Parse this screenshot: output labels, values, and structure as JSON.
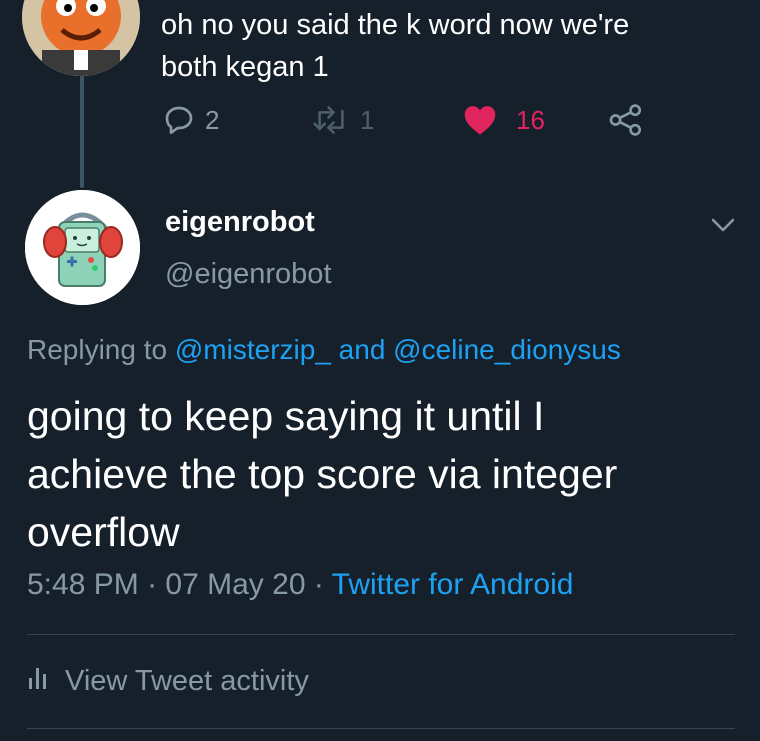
{
  "prev_tweet": {
    "text_line1": "oh no you said the k word now we're",
    "text_line2": "both kegan 1",
    "reply_count": "2",
    "retweet_count": "1",
    "like_count": "16"
  },
  "tweet": {
    "display_name": "eigenrobot",
    "handle": "@eigenrobot",
    "replying_prefix": "Replying to",
    "mention1": "@misterzip_",
    "replying_and": "and",
    "mention2": "@celine_dionysus",
    "text_line1": "going to keep saying it until I",
    "text_line2": "achieve the top score via integer",
    "text_line3": "overflow",
    "time": "5:48 PM",
    "date": "07 May 20",
    "source": "Twitter for Android",
    "separator": "·",
    "view_activity": "View Tweet activity"
  },
  "colors": {
    "background": "#15202b",
    "secondary_text": "#8899a6",
    "link": "#1da1f2",
    "like": "#e0245e",
    "divider": "#38444d"
  },
  "icons": [
    "reply-icon",
    "retweet-icon",
    "heart-icon",
    "share-icon",
    "chevron-down-icon",
    "analytics-icon"
  ]
}
